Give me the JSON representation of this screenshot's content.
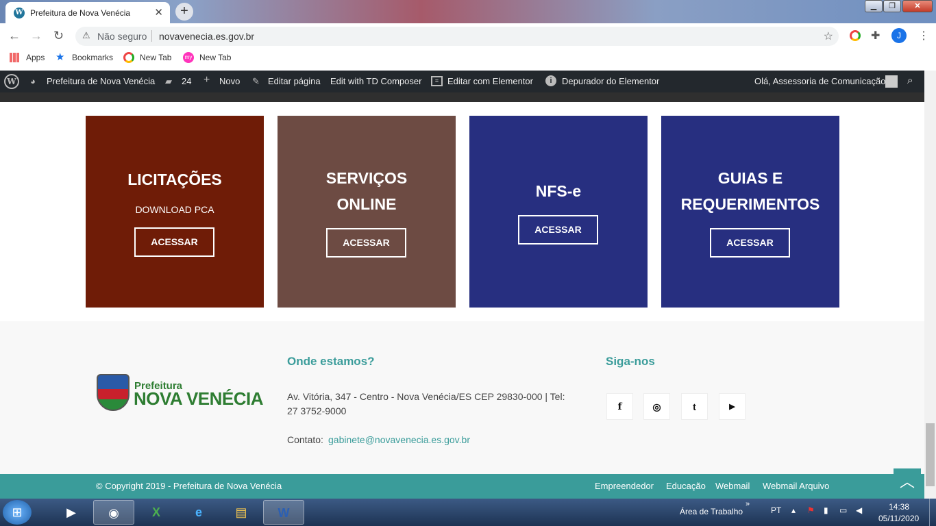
{
  "browser": {
    "tab_title": "Prefeitura de Nova Venécia",
    "tab_icon": "W",
    "new_tab": "+",
    "close_tab": "✕",
    "security_label": "Não seguro",
    "url": "novavenecia.es.gov.br",
    "profile_initial": "J",
    "bookmarks": [
      {
        "label": "Apps",
        "icon": "apps-grid-icon"
      },
      {
        "label": "Bookmarks",
        "icon": "star-icon"
      },
      {
        "label": "New Tab",
        "icon": "chrome-icon"
      },
      {
        "label": "New Tab",
        "icon": "my-icon"
      }
    ]
  },
  "wp_admin_bar": {
    "site_name": "Prefeitura de Nova Venécia",
    "comments_count": "24",
    "new_label": "Novo",
    "edit_page": "Editar página",
    "td_composer": "Edit with TD Composer",
    "elementor_edit": "Editar com Elementor",
    "elementor_debug": "Depurador do Elementor",
    "greeting": "Olá, Assessoria de Comunicação"
  },
  "cards": [
    {
      "title_lines": [
        "LICITAÇÕES"
      ],
      "subtitle": "DOWNLOAD PCA",
      "button": "ACESSAR",
      "color": "#6f1c07"
    },
    {
      "title_lines": [
        "SERVIÇOS",
        "ONLINE"
      ],
      "subtitle": "",
      "button": "ACESSAR",
      "color": "#6d4b43"
    },
    {
      "title_lines": [
        "NFS-e"
      ],
      "subtitle": "",
      "button": "ACESSAR",
      "color": "#272f80"
    },
    {
      "title_lines": [
        "GUIAS E",
        "REQUERIMENTOS"
      ],
      "subtitle": "",
      "button": "ACESSAR",
      "color": "#272f80"
    }
  ],
  "footer": {
    "logo_small": "Prefeitura",
    "logo_big": "NOVA VENÉCIA",
    "where_heading": "Onde estamos?",
    "address_line1": "Av. Vitória, 347 - Centro - Nova Venécia/ES CEP 29830-000 | Tel:",
    "address_line2": "27 3752-9000",
    "contact_label": "Contato:",
    "contact_email": "gabinete@novavenecia.es.gov.br",
    "follow_heading": "Siga-nos",
    "social": [
      {
        "icon": "facebook-icon",
        "glyph": "f"
      },
      {
        "icon": "instagram-icon",
        "glyph": "◎"
      },
      {
        "icon": "twitter-icon",
        "glyph": "t"
      },
      {
        "icon": "youtube-icon",
        "glyph": "▶"
      }
    ],
    "copyright": "© Copyright 2019 - Prefeitura de Nova Venécia",
    "links": [
      "Empreendedor",
      "Educação",
      "Webmail",
      "Webmail Arquivo"
    ],
    "accent_color": "#3a9c9a"
  },
  "taskbar": {
    "desktop_label": "Área de Trabalho",
    "lang": "PT",
    "time": "14:38",
    "date": "05/11/2020"
  }
}
